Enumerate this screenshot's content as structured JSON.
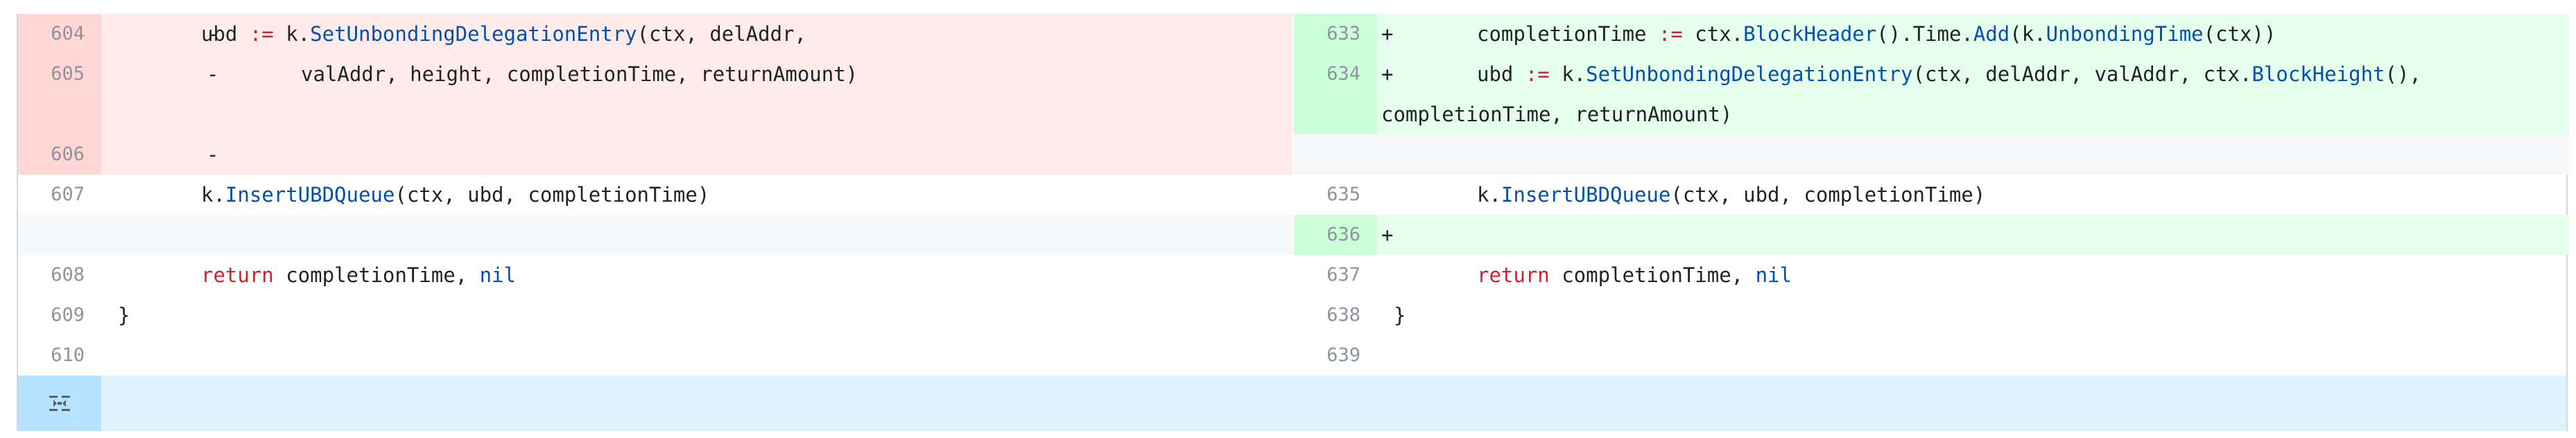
{
  "diff": {
    "left": [
      {
        "num": "604",
        "sign": "-",
        "type": "del"
      },
      {
        "num": "605",
        "sign": "-",
        "type": "del"
      },
      {
        "num": "606",
        "sign": "-",
        "type": "del"
      },
      {
        "num": "607",
        "sign": "",
        "type": "ctx"
      },
      {
        "num": "608",
        "sign": "",
        "type": "ctx"
      },
      {
        "num": "609",
        "sign": "",
        "type": "ctx"
      },
      {
        "num": "610",
        "sign": "",
        "type": "ctx"
      }
    ],
    "right": [
      {
        "num": "633",
        "sign": "+",
        "type": "add"
      },
      {
        "num": "634",
        "sign": "+",
        "type": "add"
      },
      {
        "num": "635",
        "sign": "",
        "type": "ctx"
      },
      {
        "num": "636",
        "sign": "+",
        "type": "add"
      },
      {
        "num": "637",
        "sign": "",
        "type": "ctx"
      },
      {
        "num": "638",
        "sign": "",
        "type": "ctx"
      },
      {
        "num": "639",
        "sign": "",
        "type": "ctx"
      }
    ],
    "tokens": {
      "l604_a": "ubd ",
      "l604_op": ":=",
      "l604_b": " k.",
      "l604_fn": "SetUnbondingDelegationEntry",
      "l604_c": "(ctx, delAddr,",
      "l605": "valAddr, height, completionTime, returnAmount)",
      "l607_a": "k.",
      "l607_fn": "InsertUBDQueue",
      "l607_b": "(ctx, ubd, completionTime)",
      "l608_kw": "return",
      "l608_a": " completionTime, ",
      "l608_nil": "nil",
      "l609": "}",
      "r633_a": "completionTime ",
      "r633_op": ":=",
      "r633_b": " ctx.",
      "r633_fn1": "BlockHeader",
      "r633_c": "().Time.",
      "r633_fn2": "Add",
      "r633_d": "(k.",
      "r633_fn3": "UnbondingTime",
      "r633_e": "(ctx))",
      "r634_a": "ubd ",
      "r634_op": ":=",
      "r634_b": " k.",
      "r634_fn1": "SetUnbondingDelegationEntry",
      "r634_c": "(ctx, delAddr, valAddr, ctx.",
      "r634_fn2": "BlockHeight",
      "r634_d": "(),",
      "r634_wrap": "completionTime, returnAmount)",
      "r635_a": "k.",
      "r635_fn": "InsertUBDQueue",
      "r635_b": "(ctx, ubd, completionTime)",
      "r637_kw": "return",
      "r637_a": " completionTime, ",
      "r637_nil": "nil",
      "r638": "}"
    }
  },
  "colors": {
    "del_num_bg": "#ffd7d5",
    "del_line_bg": "#ffebe9",
    "add_num_bg": "#ccffd8",
    "add_line_bg": "#e6ffec",
    "keyword": "#cf222e",
    "function": "#0550ae"
  },
  "expand_icon": "expand-icon"
}
